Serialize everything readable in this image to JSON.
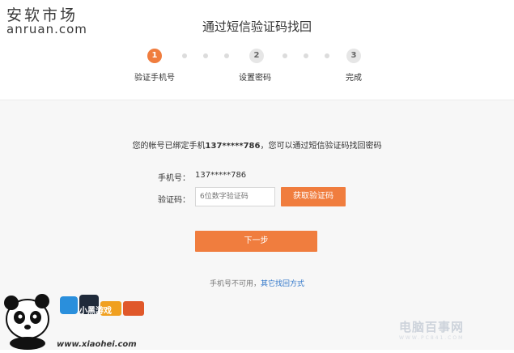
{
  "watermark_top": {
    "cn": "安软市场",
    "en": "anruan.com"
  },
  "title": "通过短信验证码找回",
  "steps": [
    {
      "num": "1",
      "label": "验证手机号",
      "state": "active"
    },
    {
      "num": "2",
      "label": "设置密码",
      "state": "todo"
    },
    {
      "num": "3",
      "label": "完成",
      "state": "todo"
    }
  ],
  "notice": {
    "prefix": "您的帐号已绑定手机",
    "phone": "137*****786",
    "suffix": "，您可以通过短信验证码找回密码"
  },
  "form": {
    "phone_label": "手机号：",
    "phone_value": "137*****786",
    "code_label": "验证码：",
    "code_placeholder": "6位数字验证码",
    "get_code_button": "获取验证码",
    "next_button": "下一步"
  },
  "alt": {
    "text": "手机号不可用，",
    "link": "其它找回方式"
  },
  "watermark_bottom": {
    "left_logo": "小黑游戏",
    "left_url": "www.xiaohei.com",
    "right_brand": "电脑百事网",
    "right_url": "WWW.PC841.COM"
  },
  "colors": {
    "accent": "#f07d3e",
    "link": "#2f76c9"
  }
}
